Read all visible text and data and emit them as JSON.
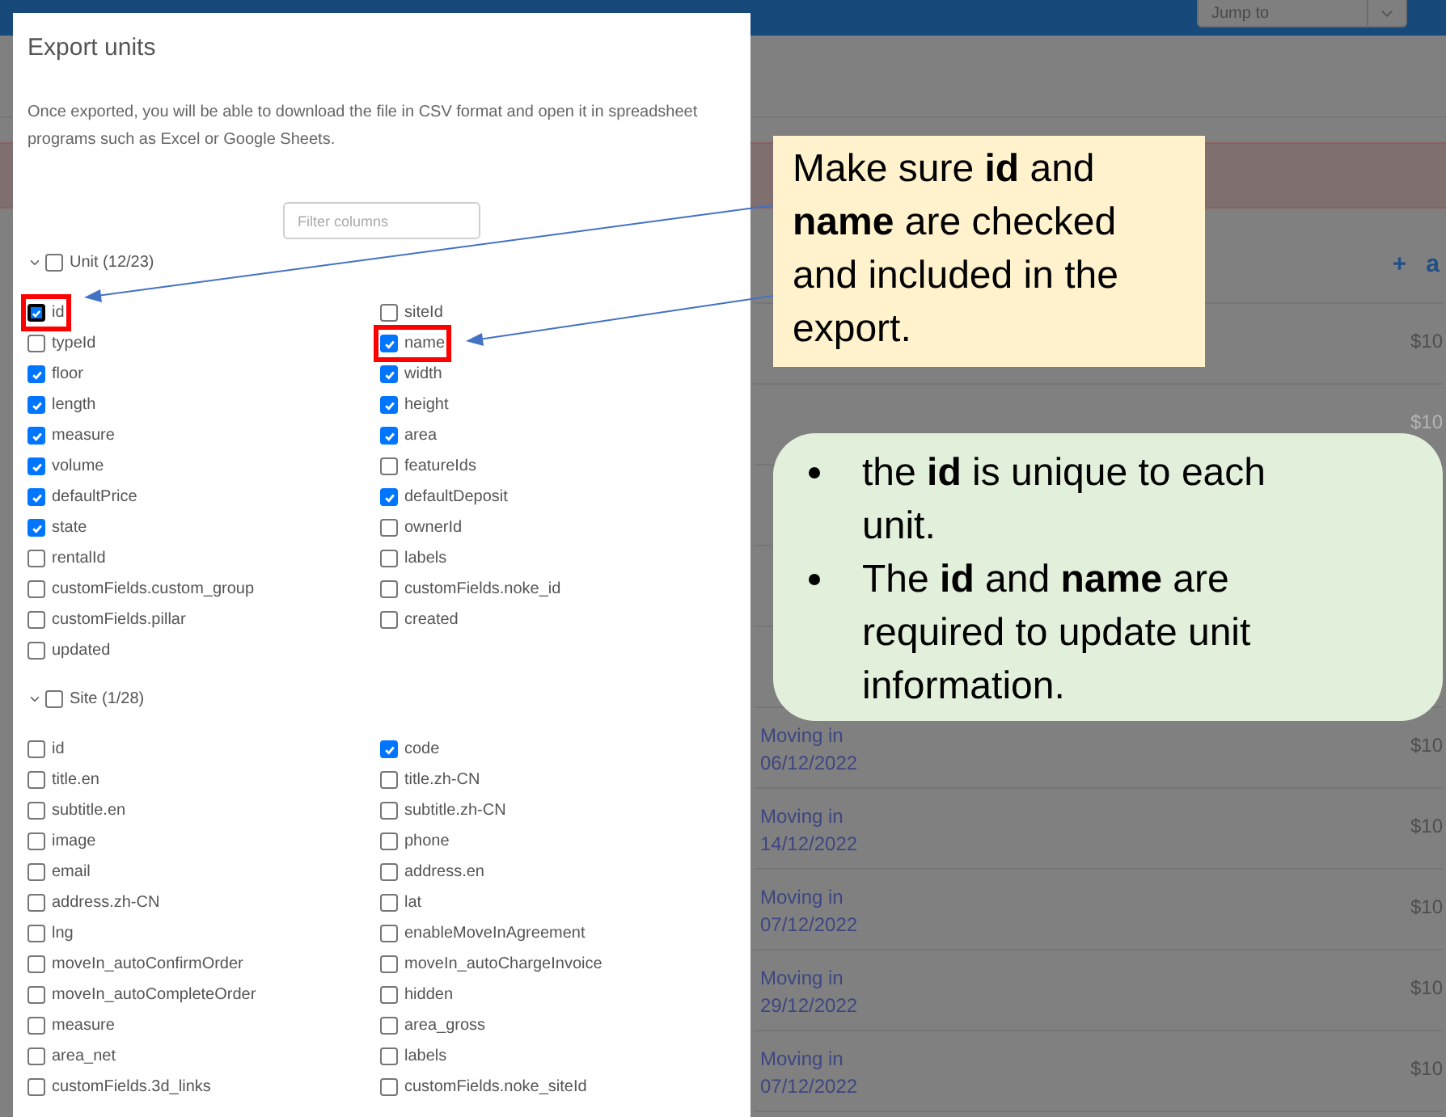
{
  "top_bar": {
    "jump_to": {
      "placeholder": "Jump to"
    }
  },
  "list": {
    "header_actions": [
      "+",
      "a"
    ],
    "rows": [
      {
        "kind": "entry",
        "price": "$10",
        "dimmed": false
      },
      {
        "kind": "entry",
        "price": "$10",
        "dimmed": true
      },
      {
        "kind": "empty"
      },
      {
        "kind": "empty"
      },
      {
        "kind": "empty"
      },
      {
        "kind": "entry",
        "title": "Moving in",
        "date": "06/12/2022",
        "price": "$10",
        "dimmed": false
      },
      {
        "kind": "entry",
        "title": "Moving in",
        "date": "14/12/2022",
        "price": "$10",
        "dimmed": false
      },
      {
        "kind": "entry",
        "title": "Moving in",
        "date": "07/12/2022",
        "price": "$10",
        "dimmed": false
      },
      {
        "kind": "entry",
        "title": "Moving in",
        "date": "29/12/2022",
        "price": "$10",
        "dimmed": false
      },
      {
        "kind": "entry",
        "title": "Moving in",
        "date": "07/12/2022",
        "price": "$10",
        "dimmed": false
      }
    ]
  },
  "dialog": {
    "title": "Export units",
    "description": "Once exported, you will be able to download the file in CSV format and open it in spreadsheet programs such as Excel or Google Sheets.",
    "filter": {
      "placeholder": "Filter columns"
    },
    "groups": [
      {
        "label": "Unit (12/23)",
        "expanded": true,
        "checked": false,
        "fields": [
          {
            "label": "id",
            "checked": true,
            "highlighted": true
          },
          {
            "label": "siteId",
            "checked": false,
            "highlighted": false
          },
          {
            "label": "typeId",
            "checked": false,
            "highlighted": false
          },
          {
            "label": "name",
            "checked": true,
            "highlighted": true
          },
          {
            "label": "floor",
            "checked": true,
            "highlighted": false
          },
          {
            "label": "width",
            "checked": true,
            "highlighted": false
          },
          {
            "label": "length",
            "checked": true,
            "highlighted": false
          },
          {
            "label": "height",
            "checked": true,
            "highlighted": false
          },
          {
            "label": "measure",
            "checked": true,
            "highlighted": false
          },
          {
            "label": "area",
            "checked": true,
            "highlighted": false
          },
          {
            "label": "volume",
            "checked": true,
            "highlighted": false
          },
          {
            "label": "featureIds",
            "checked": false,
            "highlighted": false
          },
          {
            "label": "defaultPrice",
            "checked": true,
            "highlighted": false
          },
          {
            "label": "defaultDeposit",
            "checked": true,
            "highlighted": false
          },
          {
            "label": "state",
            "checked": true,
            "highlighted": false
          },
          {
            "label": "ownerId",
            "checked": false,
            "highlighted": false
          },
          {
            "label": "rentalId",
            "checked": false,
            "highlighted": false
          },
          {
            "label": "labels",
            "checked": false,
            "highlighted": false
          },
          {
            "label": "customFields.custom_group",
            "checked": false,
            "highlighted": false
          },
          {
            "label": "customFields.noke_id",
            "checked": false,
            "highlighted": false
          },
          {
            "label": "customFields.pillar",
            "checked": false,
            "highlighted": false
          },
          {
            "label": "created",
            "checked": false,
            "highlighted": false
          },
          {
            "label": "updated",
            "checked": false,
            "highlighted": false
          }
        ]
      },
      {
        "label": "Site (1/28)",
        "expanded": true,
        "checked": false,
        "fields": [
          {
            "label": "id",
            "checked": false,
            "highlighted": false
          },
          {
            "label": "code",
            "checked": true,
            "highlighted": false
          },
          {
            "label": "title.en",
            "checked": false,
            "highlighted": false
          },
          {
            "label": "title.zh-CN",
            "checked": false,
            "highlighted": false
          },
          {
            "label": "subtitle.en",
            "checked": false,
            "highlighted": false
          },
          {
            "label": "subtitle.zh-CN",
            "checked": false,
            "highlighted": false
          },
          {
            "label": "image",
            "checked": false,
            "highlighted": false
          },
          {
            "label": "phone",
            "checked": false,
            "highlighted": false
          },
          {
            "label": "email",
            "checked": false,
            "highlighted": false
          },
          {
            "label": "address.en",
            "checked": false,
            "highlighted": false
          },
          {
            "label": "address.zh-CN",
            "checked": false,
            "highlighted": false
          },
          {
            "label": "lat",
            "checked": false,
            "highlighted": false
          },
          {
            "label": "lng",
            "checked": false,
            "highlighted": false
          },
          {
            "label": "enableMoveInAgreement",
            "checked": false,
            "highlighted": false
          },
          {
            "label": "moveIn_autoConfirmOrder",
            "checked": false,
            "highlighted": false
          },
          {
            "label": "moveIn_autoChargeInvoice",
            "checked": false,
            "highlighted": false
          },
          {
            "label": "moveIn_autoCompleteOrder",
            "checked": false,
            "highlighted": false
          },
          {
            "label": "hidden",
            "checked": false,
            "highlighted": false
          },
          {
            "label": "measure",
            "checked": false,
            "highlighted": false
          },
          {
            "label": "area_gross",
            "checked": false,
            "highlighted": false
          },
          {
            "label": "area_net",
            "checked": false,
            "highlighted": false
          },
          {
            "label": "labels",
            "checked": false,
            "highlighted": false
          },
          {
            "label": "customFields.3d_links",
            "checked": false,
            "highlighted": false
          },
          {
            "label": "customFields.noke_siteId",
            "checked": false,
            "highlighted": false
          }
        ]
      }
    ]
  },
  "callouts": [
    {
      "kind": "note",
      "text": "Make sure **id** and **name** are checked and included in the export."
    },
    {
      "kind": "bullets",
      "items": [
        "the **id** is unique to each unit.",
        "The **id** and **name** are required to update unit information."
      ]
    }
  ]
}
